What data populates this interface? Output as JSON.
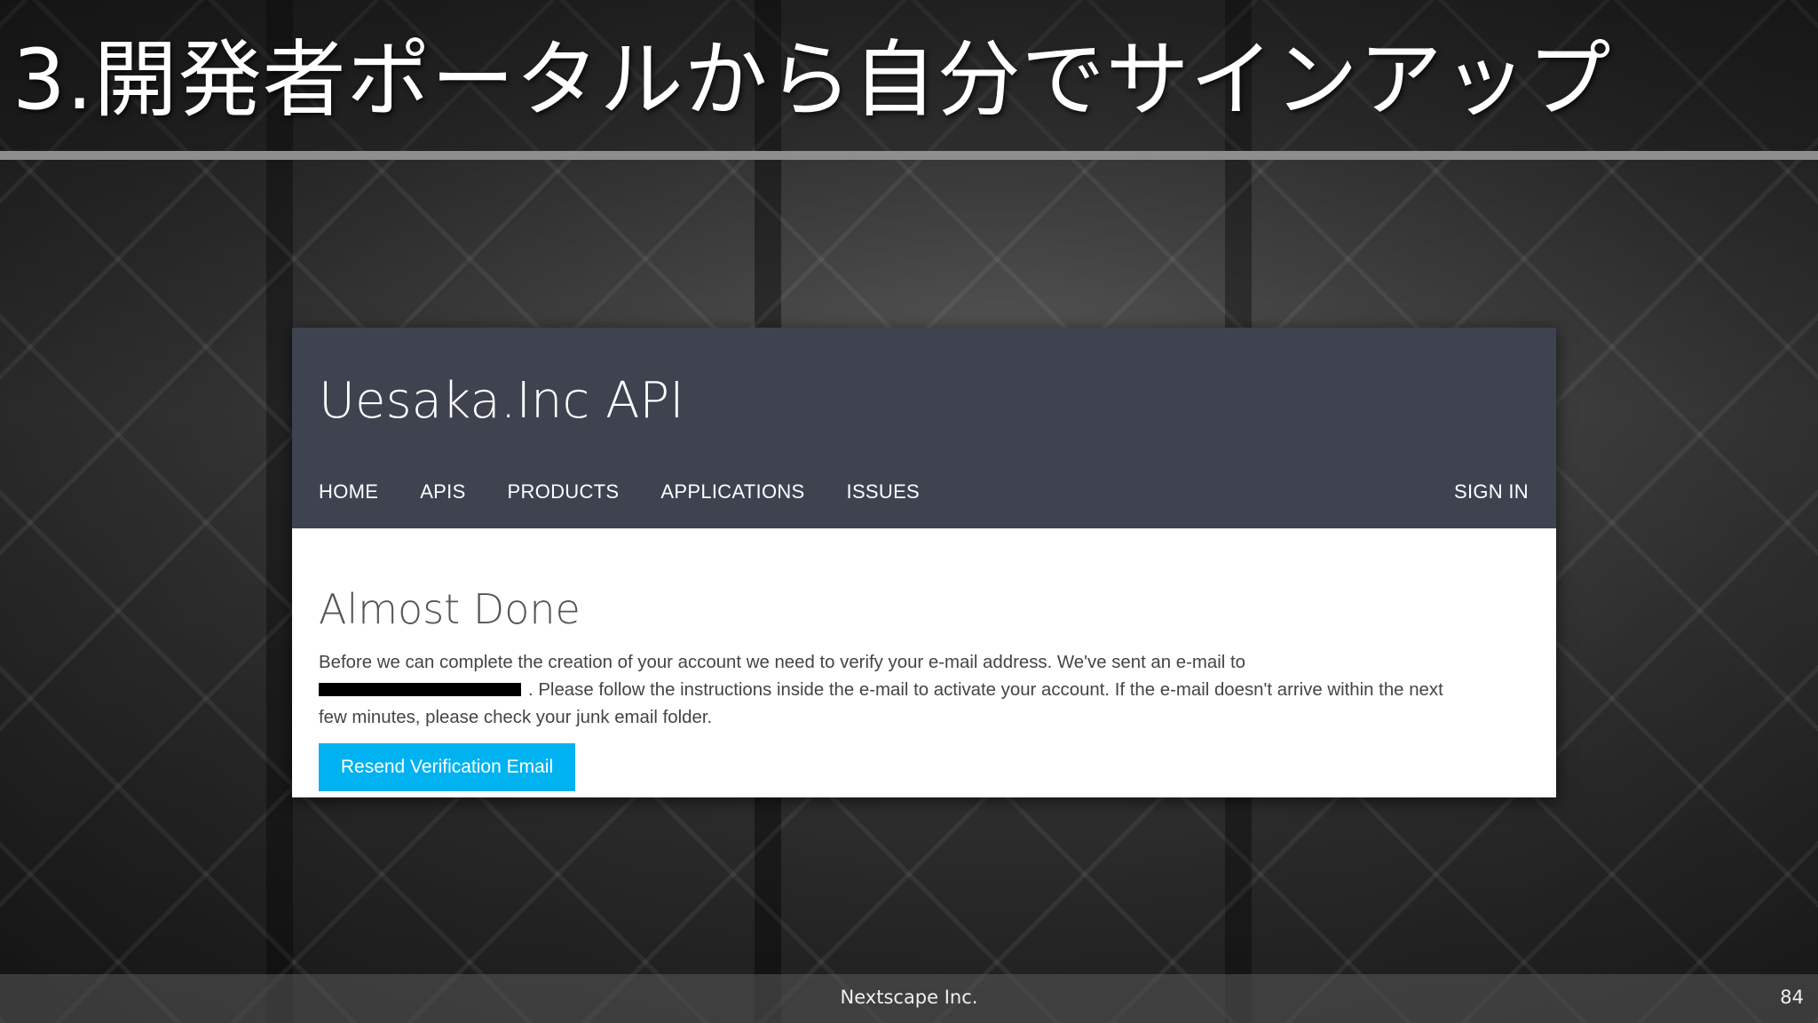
{
  "slide": {
    "title": "3.開発者ポータルから自分でサインアップ",
    "page_number": "84",
    "company": "Nextscape Inc."
  },
  "portal": {
    "brand": "Uesaka.Inc API",
    "nav": {
      "items": [
        "HOME",
        "APIS",
        "PRODUCTS",
        "APPLICATIONS",
        "ISSUES"
      ],
      "sign_in": "SIGN IN"
    },
    "heading": "Almost Done",
    "message": {
      "line1": "Before we can complete the creation of your account we need to verify your e-mail address. We've sent an e-mail to",
      "line2_after_redaction": ". Please follow the instructions inside the e-mail to activate your account. If the e-mail doesn't arrive within the next",
      "line3": "few minutes, please check your junk email folder."
    },
    "resend_button": "Resend Verification Email"
  },
  "colors": {
    "header_bg": "#3f4350",
    "button_bg": "#00b3f0",
    "rule": "#8e8e8e"
  }
}
